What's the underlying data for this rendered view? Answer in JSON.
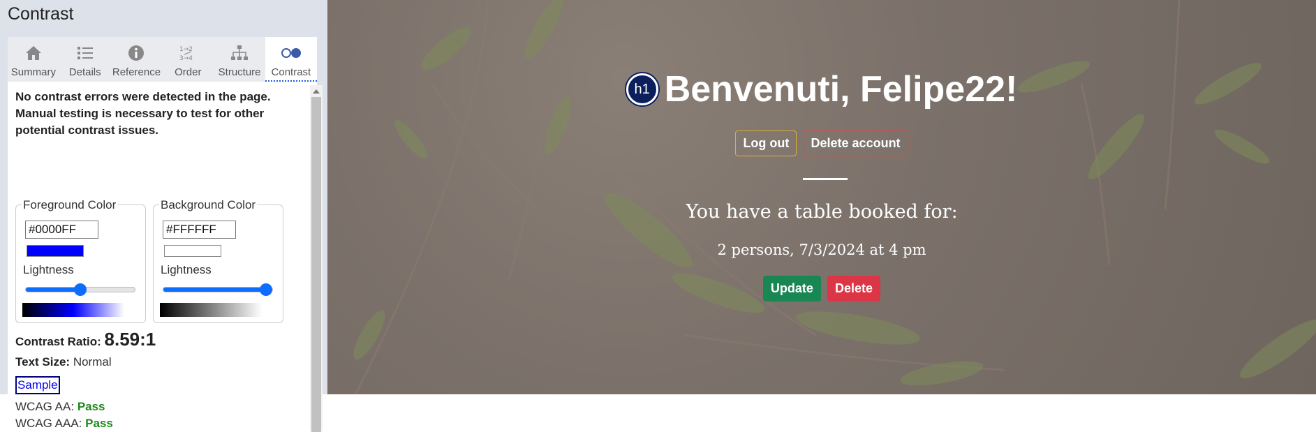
{
  "panel": {
    "title": "Contrast",
    "tabs": [
      {
        "label": "Summary",
        "icon": "home-icon",
        "active": false
      },
      {
        "label": "Details",
        "icon": "list-icon",
        "active": false
      },
      {
        "label": "Reference",
        "icon": "info-icon",
        "active": false
      },
      {
        "label": "Order",
        "icon": "order-icon",
        "active": false
      },
      {
        "label": "Structure",
        "icon": "structure-icon",
        "active": false
      },
      {
        "label": "Contrast",
        "icon": "contrast-icon",
        "active": true
      }
    ],
    "message": "No contrast errors were detected in the page. Manual testing is necessary to test for other potential contrast issues.",
    "foreground": {
      "legend": "Foreground Color",
      "hex": "#0000FF",
      "swatch_color": "#0000FF",
      "lightness_label": "Lightness",
      "lightness": 0.5
    },
    "background": {
      "legend": "Background Color",
      "hex": "#FFFFFF",
      "swatch_color": "#FFFFFF",
      "lightness_label": "Lightness",
      "lightness": 1.0
    },
    "ratio_label": "Contrast Ratio:",
    "ratio_value": "8.59:1",
    "text_size_label": "Text Size:",
    "text_size_value": "Normal",
    "sample": "Sample",
    "wcag_aa_label": "WCAG AA:",
    "wcag_aa_value": "Pass",
    "wcag_aaa_label": "WCAG AAA:",
    "wcag_aaa_value": "Pass"
  },
  "hero": {
    "heading_badge": "h1",
    "heading": "Benvenuti, Felipe22!",
    "logout": "Log out",
    "delete_account": "Delete account",
    "booked": "You have a table booked for:",
    "booking_details": "2 persons, 7/3/2024 at 4 pm",
    "update": "Update",
    "delete": "Delete",
    "colors": {
      "update": "#198754",
      "delete": "#dc3545",
      "logout_border": "#e0b030",
      "delete_border": "#d84a4a"
    }
  }
}
